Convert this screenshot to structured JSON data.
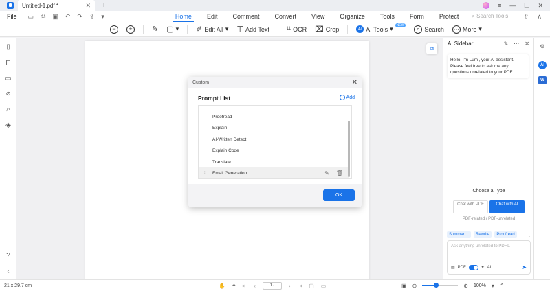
{
  "titlebar": {
    "tab_title": "Untitled-1.pdf *",
    "close_icon": "close-icon",
    "plus_icon": "plus-icon",
    "controls": [
      "avatar",
      "menu-icon",
      "minimize-icon",
      "restore-icon",
      "close-icon"
    ]
  },
  "menubar": {
    "file_label": "File",
    "menus": [
      {
        "label": "Home",
        "active": true
      },
      {
        "label": "Edit",
        "active": false
      },
      {
        "label": "Comment",
        "active": false
      },
      {
        "label": "Convert",
        "active": false
      },
      {
        "label": "View",
        "active": false
      },
      {
        "label": "Organize",
        "active": false
      },
      {
        "label": "Tools",
        "active": false
      },
      {
        "label": "Form",
        "active": false
      },
      {
        "label": "Protect",
        "active": false
      }
    ],
    "search_placeholder": "Search Tools"
  },
  "toolbar": {
    "edit_all": "Edit All",
    "add_text": "Add Text",
    "ocr": "OCR",
    "crop": "Crop",
    "ai_tools": "AI Tools",
    "ai_badge": "AI",
    "new_badge": "NEW",
    "search": "Search",
    "more": "More"
  },
  "modal": {
    "header": "Custom",
    "title": "Prompt List",
    "add_label": "Add",
    "items": [
      {
        "label": "Proofread"
      },
      {
        "label": "Explain"
      },
      {
        "label": "AI-Written Detect"
      },
      {
        "label": "Explain Code"
      },
      {
        "label": "Translate"
      },
      {
        "label": "Email Generation",
        "highlighted": true
      }
    ],
    "ok_label": "OK"
  },
  "ai_sidebar": {
    "title": "AI Sidebar",
    "greeting": "Hello, I'm Lumi, your AI assistant. Please feel free to ask me any questions unrelated to your PDF.",
    "choose_type": "Choose a Type",
    "chat_pdf": "Chat with PDF",
    "chat_ai": "Chat with AI",
    "pdf_related": "PDF-related / PDF-unrelated",
    "chips": [
      "Summari...",
      "Rewrite",
      "Proofread"
    ],
    "ask_placeholder": "Ask anything unrelated to PDFs.",
    "pdf_label": "PDF",
    "ai_label": "AI"
  },
  "statusbar": {
    "dimensions": "21 x 29.7 cm",
    "page_value": "1 /",
    "zoom": "100%",
    "zoom_level": 0.38
  },
  "colors": {
    "accent": "#1a73e8"
  }
}
